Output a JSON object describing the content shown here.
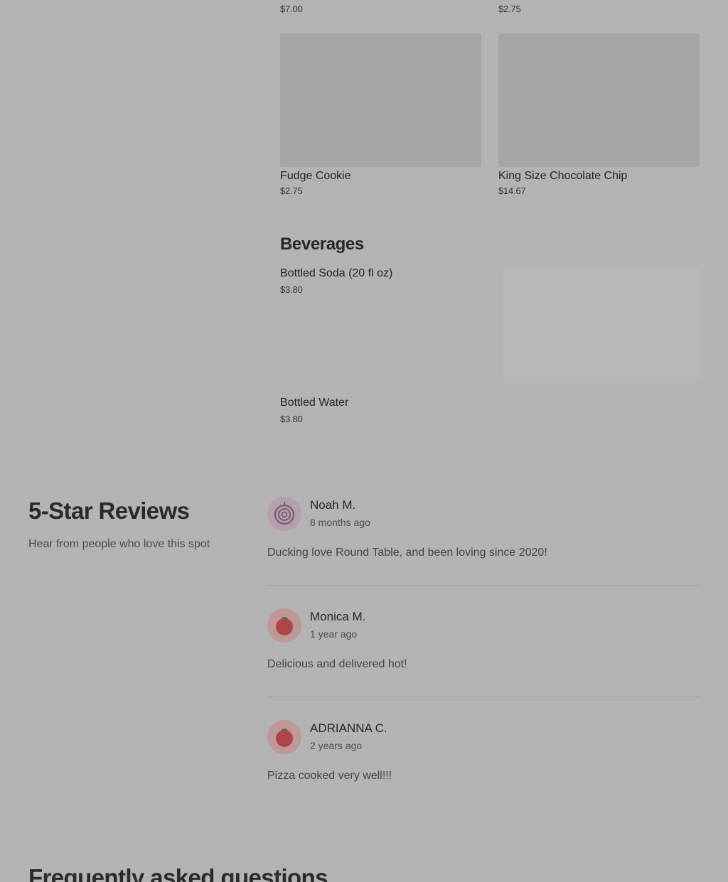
{
  "menu": {
    "top_row": [
      {
        "price": "$7.00"
      },
      {
        "price": "$2.75"
      }
    ],
    "desserts": [
      {
        "name": "Fudge Cookie",
        "price": "$2.75"
      },
      {
        "name": "King Size Chocolate Chip",
        "price": "$14.67"
      }
    ],
    "beverages": {
      "title": "Beverages",
      "items": [
        {
          "name": "Bottled Soda (20 fl oz)",
          "price": "$3.80"
        },
        {
          "name": "Bottled Water",
          "price": "$3.80"
        }
      ]
    }
  },
  "reviews": {
    "title": "5-Star Reviews",
    "subtitle": "Hear from people who love this spot",
    "items": [
      {
        "name": "Noah M.",
        "when": "8 months ago",
        "text": "Ducking love Round Table, and been loving since 2020!",
        "avatar_icon": "onion-icon"
      },
      {
        "name": "Monica M.",
        "when": "1 year ago",
        "text": "Delicious and delivered hot!",
        "avatar_icon": "tomato-icon"
      },
      {
        "name": "ADRIANNA C.",
        "when": "2 years ago",
        "text": "Pizza cooked very well!!!",
        "avatar_icon": "tomato-icon"
      }
    ]
  },
  "faq": {
    "title": "Frequently asked questions"
  }
}
